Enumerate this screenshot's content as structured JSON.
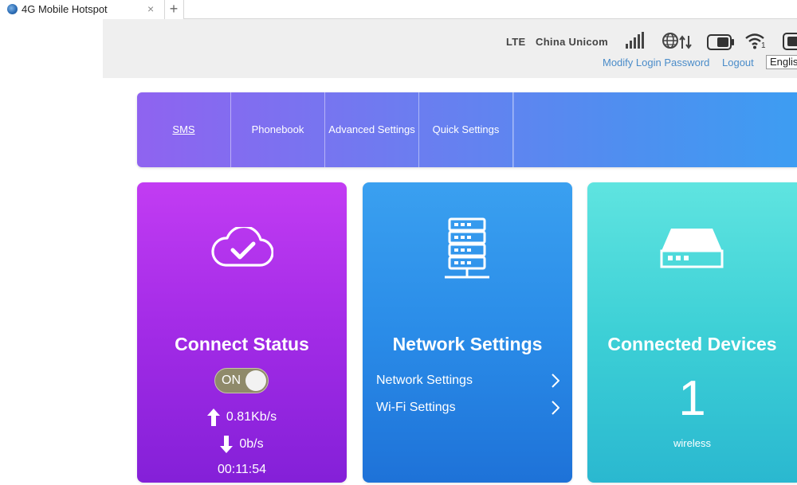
{
  "browser": {
    "tab_title": "4G Mobile Hotspot",
    "close_glyph": "×",
    "new_tab_glyph": "+"
  },
  "header": {
    "network_type": "LTE",
    "operator": "China Unicom",
    "wifi_clients": "1",
    "modify_password": "Modify Login Password",
    "logout": "Logout",
    "language": "English",
    "icons": [
      "signal-strength-icon",
      "roaming-data-icon",
      "battery-icon",
      "wifi-icon",
      "sim-card-icon"
    ]
  },
  "nav": {
    "items": [
      {
        "label": "SMS",
        "active": true
      },
      {
        "label": "Phonebook"
      },
      {
        "label": "Advanced Settings"
      },
      {
        "label": "Quick Settings"
      }
    ]
  },
  "cards": {
    "connect": {
      "title": "Connect Status",
      "toggle_label": "ON",
      "upload_rate": "0.81Kb/s",
      "download_rate": "0b/s",
      "connected_time": "00:11:54",
      "icon": "cloud-check-icon"
    },
    "network": {
      "title": "Network Settings",
      "links": [
        {
          "label": "Network Settings"
        },
        {
          "label": "Wi-Fi Settings"
        }
      ],
      "icon": "server-icon"
    },
    "devices": {
      "title": "Connected Devices",
      "count": "1",
      "type": "wireless",
      "icon": "router-icon"
    }
  },
  "colors": {
    "connect_card": "#a22be6",
    "network_card": "#2a8ce8",
    "devices_card": "#3dd0d6",
    "link": "#4a8cc9",
    "nav_start": "#8f63f0",
    "nav_end": "#3d9df2"
  }
}
